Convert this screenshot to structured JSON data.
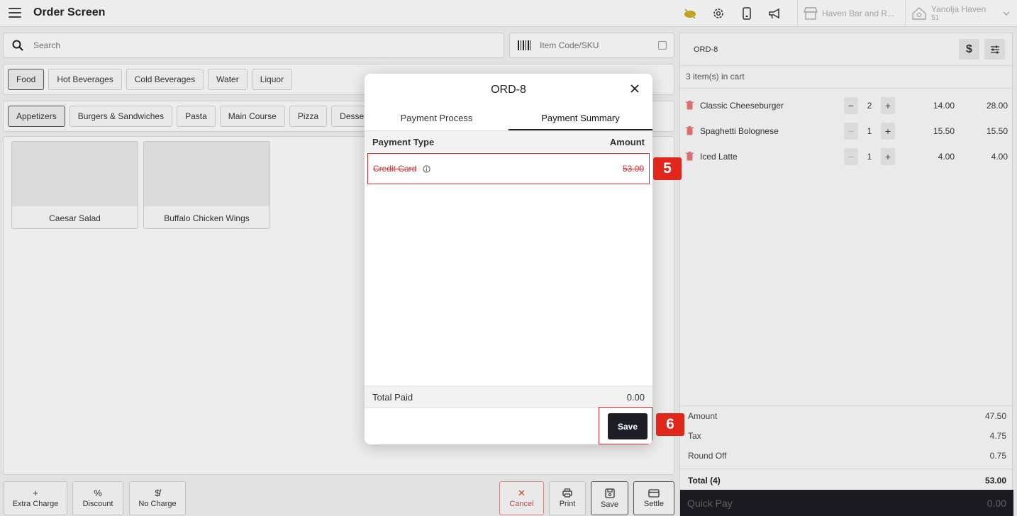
{
  "header": {
    "title": "Order Screen",
    "store": "Haven Bar and R...",
    "user_name": "Yanolja Haven",
    "user_id": "51"
  },
  "search": {
    "placeholder": "Search"
  },
  "sku": {
    "placeholder": "Item Code/SKU"
  },
  "categories": [
    "Food",
    "Hot Beverages",
    "Cold Beverages",
    "Water",
    "Liquor"
  ],
  "subcategories": [
    "Appetizers",
    "Burgers & Sandwiches",
    "Pasta",
    "Main Course",
    "Pizza",
    "Desserts"
  ],
  "items": [
    "Caesar Salad",
    "Buffalo Chicken Wings"
  ],
  "actions": {
    "extra_charge": "Extra Charge",
    "discount": "Discount",
    "no_charge": "No Charge",
    "cancel": "Cancel",
    "print": "Print",
    "save": "Save",
    "settle": "Settle"
  },
  "cart": {
    "order_id": "ORD-8",
    "currency_symbol": "$",
    "count_text": "3 item(s) in cart",
    "lines": [
      {
        "name": "Classic Cheeseburger",
        "qty": "2",
        "price": "14.00",
        "total": "28.00"
      },
      {
        "name": "Spaghetti Bolognese",
        "qty": "1",
        "price": "15.50",
        "total": "15.50"
      },
      {
        "name": "Iced Latte",
        "qty": "1",
        "price": "4.00",
        "total": "4.00"
      }
    ],
    "summary": {
      "amount_label": "Amount",
      "amount": "47.50",
      "tax_label": "Tax",
      "tax": "4.75",
      "round_label": "Round Off",
      "round": "0.75",
      "total_label": "Total (4)",
      "total": "53.00"
    },
    "quick_pay_label": "Quick Pay",
    "quick_pay_value": "0.00"
  },
  "modal": {
    "title": "ORD-8",
    "tabs": [
      "Payment Process",
      "Payment Summary"
    ],
    "col_type": "Payment Type",
    "col_amount": "Amount",
    "payment": {
      "type": "Credit Card",
      "amount": "53.00"
    },
    "total_paid_label": "Total Paid",
    "total_paid": "0.00",
    "save_label": "Save"
  },
  "steps": [
    "5",
    "6"
  ],
  "colors": {
    "highlight": "#d32f2f",
    "badge": "#e1261c",
    "dark": "#1e1e26"
  }
}
